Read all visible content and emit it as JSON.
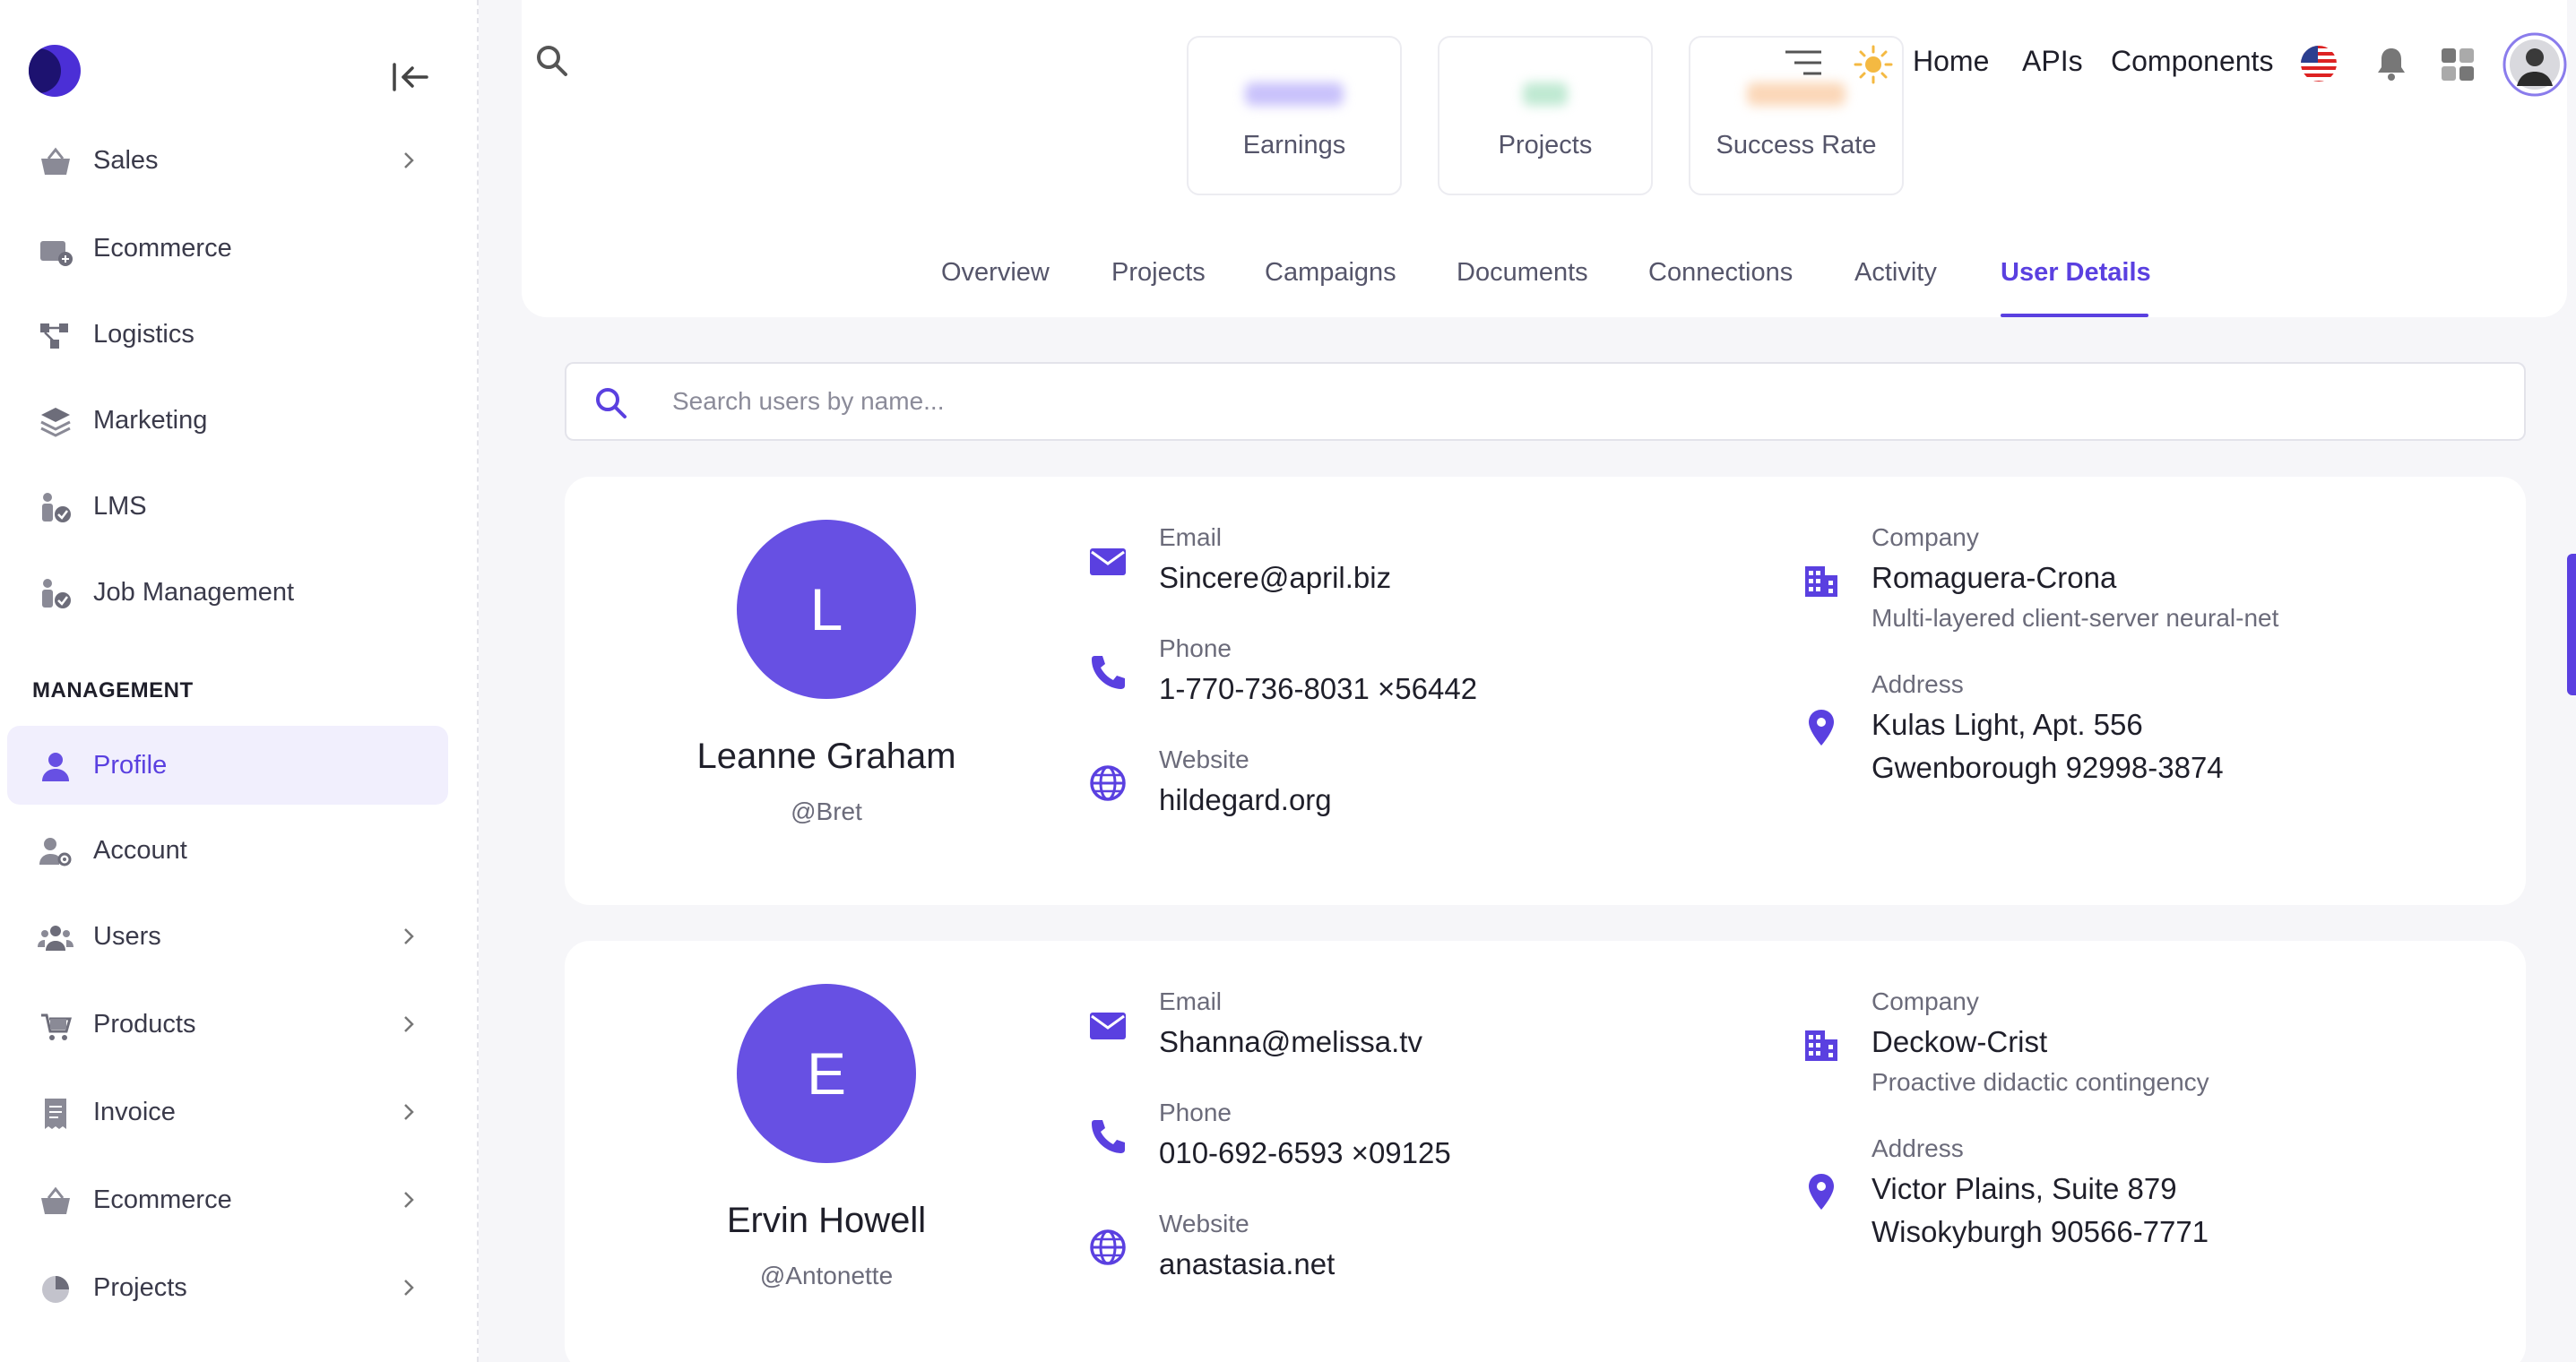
{
  "sidebar": {
    "items_top": [
      {
        "label": "Sales",
        "has_chevron": true
      },
      {
        "label": "Ecommerce",
        "has_chevron": false
      },
      {
        "label": "Logistics",
        "has_chevron": false
      },
      {
        "label": "Marketing",
        "has_chevron": false
      },
      {
        "label": "LMS",
        "has_chevron": false
      },
      {
        "label": "Job Management",
        "has_chevron": false
      }
    ],
    "section_title": "MANAGEMENT",
    "items_mgmt": [
      {
        "label": "Profile",
        "active": true
      },
      {
        "label": "Account"
      },
      {
        "label": "Users",
        "has_chevron": true
      },
      {
        "label": "Products",
        "has_chevron": true
      },
      {
        "label": "Invoice",
        "has_chevron": true
      },
      {
        "label": "Ecommerce",
        "has_chevron": true
      },
      {
        "label": "Projects",
        "has_chevron": true
      }
    ]
  },
  "topbar": {
    "links": [
      "Home",
      "APIs",
      "Components"
    ]
  },
  "stats": [
    {
      "label": "Earnings",
      "accent": "#c9c2fb"
    },
    {
      "label": "Projects",
      "accent": "#bfe9d2"
    },
    {
      "label": "Success Rate",
      "accent": "#fbd7b8"
    }
  ],
  "tabs": [
    "Overview",
    "Projects",
    "Campaigns",
    "Documents",
    "Connections",
    "Activity",
    "User Details"
  ],
  "active_tab": "User Details",
  "search": {
    "placeholder": "Search users by name..."
  },
  "users": [
    {
      "initial": "L",
      "name": "Leanne Graham",
      "handle": "@Bret",
      "email_label": "Email",
      "email": "Sincere@april.biz",
      "phone_label": "Phone",
      "phone": "1-770-736-8031 ×56442",
      "website_label": "Website",
      "website": "hildegard.org",
      "company_label": "Company",
      "company": "Romaguera-Crona",
      "company_phrase": "Multi-layered client-server neural-net",
      "address_label": "Address",
      "address_line1": "Kulas Light, Apt. 556",
      "address_line2": "Gwenborough 92998-3874"
    },
    {
      "initial": "E",
      "name": "Ervin Howell",
      "handle": "@Antonette",
      "email_label": "Email",
      "email": "Shanna@melissa.tv",
      "phone_label": "Phone",
      "phone": "010-692-6593 ×09125",
      "website_label": "Website",
      "website": "anastasia.net",
      "company_label": "Company",
      "company": "Deckow-Crist",
      "company_phrase": "Proactive didactic contingency",
      "address_label": "Address",
      "address_line1": "Victor Plains, Suite 879",
      "address_line2": "Wisokyburgh 90566-7771"
    }
  ],
  "colors": {
    "accent": "#5a40e0",
    "avatar": "#6750e3"
  }
}
